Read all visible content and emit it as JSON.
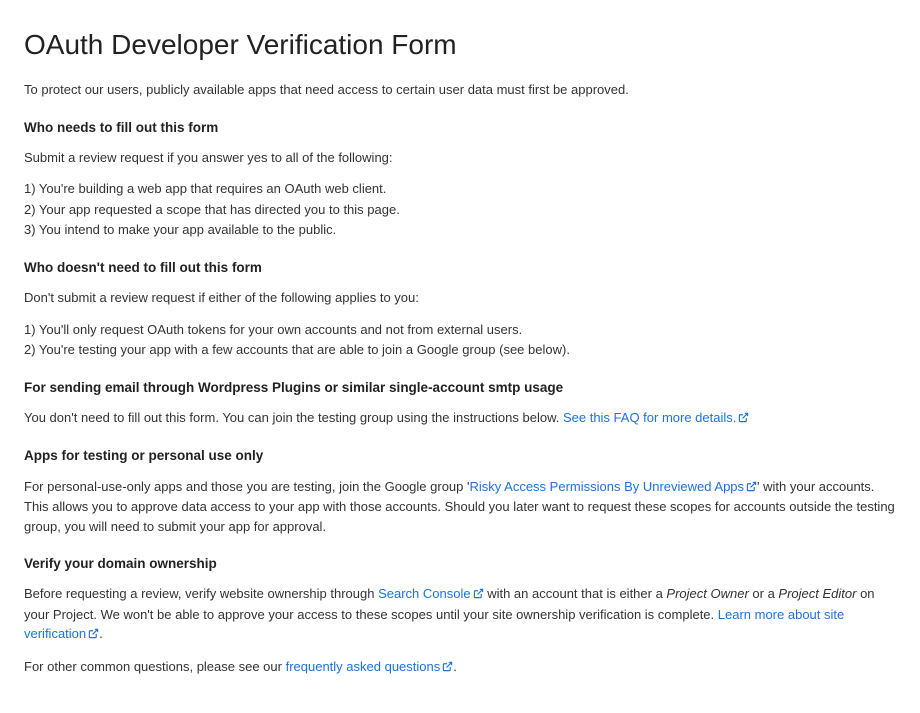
{
  "title": "OAuth Developer Verification Form",
  "intro": "To protect our users, publicly available apps that need access to certain user data must first be approved.",
  "s1": {
    "heading": "Who needs to fill out this form",
    "lead": "Submit a review request if you answer yes to all of the following:",
    "items": [
      "1) You're building a web app that requires an OAuth web client.",
      "2) Your app requested a scope that has directed you to this page.",
      "3) You intend to make your app available to the public."
    ]
  },
  "s2": {
    "heading": "Who doesn't need to fill out this form",
    "lead": "Don't submit a review request if either of the following applies to you:",
    "items": [
      "1) You'll only request OAuth tokens for your own accounts and not from external users.",
      "2) You're testing your app with a few accounts that are able to join a Google group (see below)."
    ]
  },
  "s3": {
    "heading": "For sending email through Wordpress Plugins or similar single-account smtp usage",
    "text_before_link": "You don't need to fill out this form. You can join the testing group using the instructions below. ",
    "link": "See this FAQ for more details."
  },
  "s4": {
    "heading": "Apps for testing or personal use only",
    "before": "For personal-use-only apps and those you are testing, join the Google group '",
    "link": "Risky Access Permissions By Unreviewed Apps",
    "after": "' with your accounts. This allows you to approve data access to your app with those accounts. Should you later want to request these scopes for accounts outside the testing group, you will need to submit your app for approval."
  },
  "s5": {
    "heading": "Verify your domain ownership",
    "p1_before": "Before requesting a review, verify website ownership through ",
    "p1_link": "Search Console",
    "p1_mid1": " with an account that is either a ",
    "role1": "Project Owner",
    "p1_mid2": " or a ",
    "role2": "Project Editor",
    "p1_mid3": " on your Project. We won't be able to approve your access to these scopes until your site ownership verification is complete. ",
    "p1_link2": "Learn more about site verification",
    "p1_end": ".",
    "p2_before": "For other common questions, please see our ",
    "p2_link": "frequently asked questions",
    "p2_end": "."
  }
}
